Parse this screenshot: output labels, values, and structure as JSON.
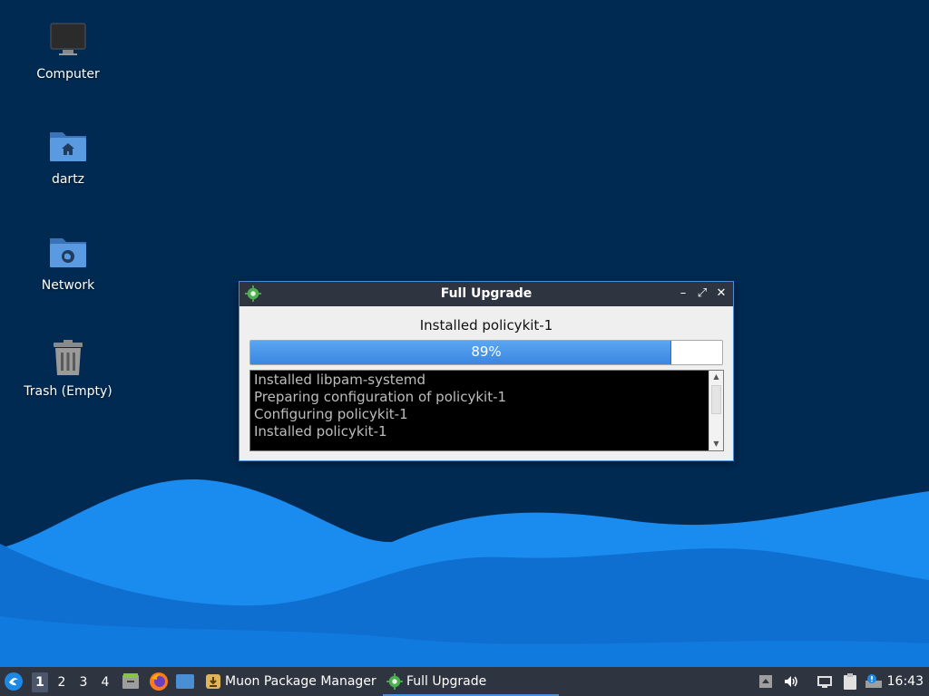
{
  "desktop": {
    "icons": [
      {
        "label": "Computer",
        "icon": "computer-icon"
      },
      {
        "label": "dartz",
        "icon": "home-folder-icon"
      },
      {
        "label": "Network",
        "icon": "network-folder-icon"
      },
      {
        "label": "Trash (Empty)",
        "icon": "trash-icon"
      }
    ],
    "colors": {
      "background": "#012a52",
      "wave_light": "#1a8cf0",
      "wave_dark": "#0e6fd1"
    }
  },
  "dialog": {
    "title": "Full Upgrade",
    "status": "Installed policykit-1",
    "progress": {
      "value": 0.89,
      "label": "89%"
    },
    "log": [
      "Installed libpam-systemd",
      "Preparing configuration of policykit-1",
      "Configuring policykit-1",
      "Installed policykit-1"
    ],
    "buttons": {
      "minimize": "–",
      "maximize": "⤢",
      "close": "✕"
    }
  },
  "taskbar": {
    "workspaces": [
      "1",
      "2",
      "3",
      "4"
    ],
    "active_workspace": "1",
    "tasks": [
      {
        "label": "Muon Package Manager",
        "icon": "muon-icon"
      },
      {
        "label": "Full Upgrade",
        "icon": "gear-icon"
      }
    ],
    "clock": "16:43"
  }
}
